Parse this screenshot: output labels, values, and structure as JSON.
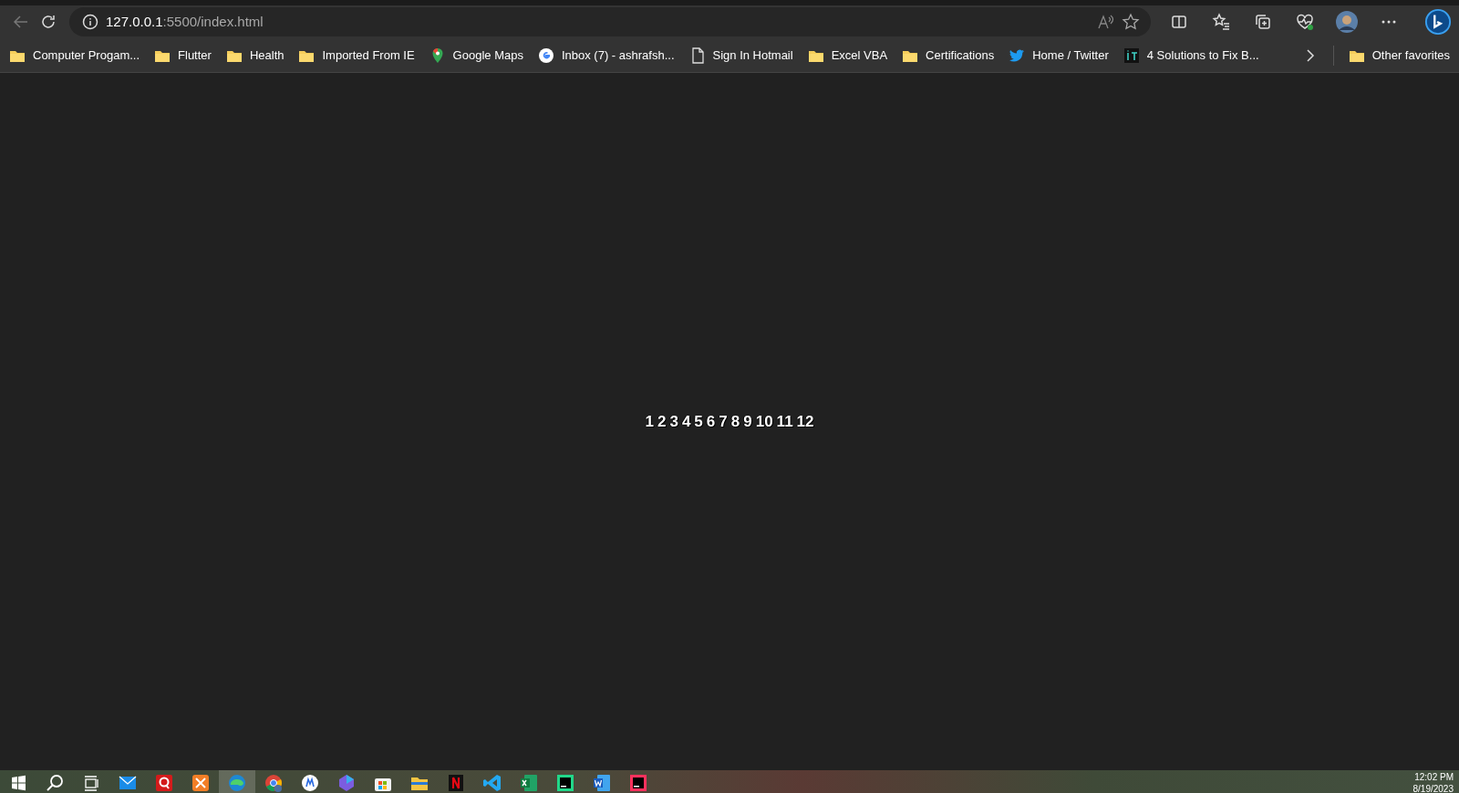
{
  "address_bar": {
    "host": "127.0.0.1",
    "path": ":5500/index.html"
  },
  "bookmarks": [
    {
      "kind": "folder",
      "label": "Computer Progam..."
    },
    {
      "kind": "folder",
      "label": "Flutter"
    },
    {
      "kind": "folder",
      "label": "Health"
    },
    {
      "kind": "folder",
      "label": "Imported From IE"
    },
    {
      "kind": "maps",
      "label": "Google Maps"
    },
    {
      "kind": "google",
      "label": "Inbox (7) - ashrafsh..."
    },
    {
      "kind": "page",
      "label": "Sign In Hotmail"
    },
    {
      "kind": "folder",
      "label": "Excel VBA"
    },
    {
      "kind": "folder",
      "label": "Certifications"
    },
    {
      "kind": "twitter",
      "label": "Home / Twitter"
    },
    {
      "kind": "it",
      "label": "4 Solutions to Fix B..."
    }
  ],
  "other_favorites": {
    "label": "Other favorites"
  },
  "numbers": [
    "1",
    "2",
    "3",
    "4",
    "5",
    "6",
    "7",
    "8",
    "9",
    "10",
    "11",
    "12"
  ],
  "taskbar": {
    "apps": [
      {
        "kind": "mail",
        "active": false
      },
      {
        "kind": "red",
        "active": false
      },
      {
        "kind": "orange",
        "active": false
      },
      {
        "kind": "edge",
        "active": true
      },
      {
        "kind": "chrome",
        "active": false
      },
      {
        "kind": "white",
        "active": false
      },
      {
        "kind": "copilot",
        "active": false
      },
      {
        "kind": "store",
        "active": false
      },
      {
        "kind": "files",
        "active": false
      },
      {
        "kind": "netflix",
        "active": false
      },
      {
        "kind": "vscode",
        "active": false
      },
      {
        "kind": "excel",
        "active": false
      },
      {
        "kind": "pycharm",
        "active": false
      },
      {
        "kind": "word",
        "active": false
      },
      {
        "kind": "intellij",
        "active": false
      }
    ],
    "time": "12:02 PM",
    "date": "8/19/2023"
  }
}
